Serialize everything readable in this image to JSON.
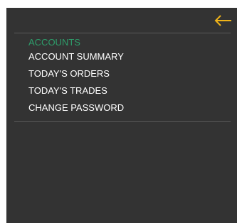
{
  "header": {
    "back_icon": "arrow-left-icon",
    "accent_color": "#f0b419"
  },
  "menu": {
    "heading": "ACCOUNTS",
    "heading_color": "#2e9e6b",
    "items": [
      {
        "label": "ACCOUNT SUMMARY"
      },
      {
        "label": "TODAY'S ORDERS"
      },
      {
        "label": "TODAY'S TRADES"
      },
      {
        "label": "CHANGE PASSWORD"
      }
    ]
  },
  "colors": {
    "panel_background": "#333333",
    "text": "#ffffff",
    "divider": "#5a5a5a"
  }
}
